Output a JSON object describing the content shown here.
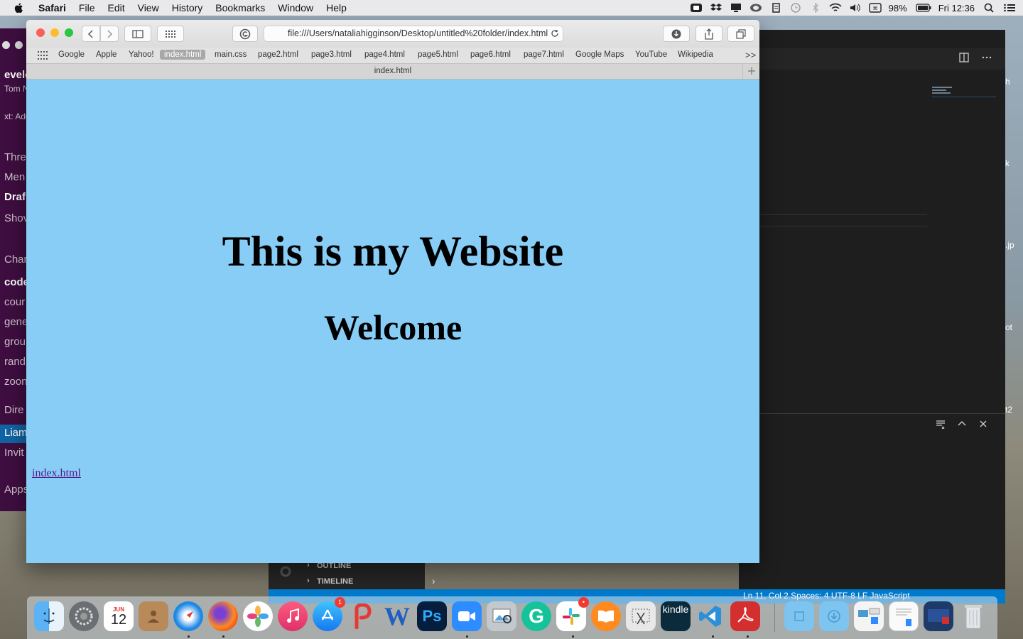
{
  "menubar": {
    "items": [
      "Safari",
      "File",
      "Edit",
      "View",
      "History",
      "Bookmarks",
      "Window",
      "Help"
    ],
    "battery": "98%",
    "clock": "Fri 12:36"
  },
  "safari": {
    "url": "file:///Users/nataliahigginson/Desktop/untitled%20folder/index.html",
    "favorites": [
      "Google",
      "Apple",
      "Yahoo!",
      "index.html",
      "main.css",
      "page2.html",
      "page3.html",
      "page4.html",
      "page5.html",
      "page6.html",
      "page7.html",
      "Google Maps",
      "YouTube",
      "Wikipedia"
    ],
    "favorites_more": ">>",
    "tab_title": "index.html",
    "page": {
      "heading": "This is my Website",
      "subheading": "Welcome",
      "link": "index.html"
    }
  },
  "slack_sidebar": {
    "top_title": "evelop",
    "top_sub": "Tom N",
    "top_sub2": "xt: Add",
    "items": [
      "Thre",
      "Men",
      "Draf",
      "Shov",
      "Char",
      "code",
      "cour",
      "gene",
      "grou",
      "rand",
      "zoon",
      "Dire",
      "Liam",
      "Invit",
      "Apps"
    ]
  },
  "vscode": {
    "outline": "OUTLINE",
    "timeline": "TIMELINE",
    "status_right": "Ln 11, Col 2    Spaces: 4    UTF-8    LF    JavaScript"
  },
  "right_strip": [
    "h",
    "k",
    ".jp",
    "ot",
    "t2"
  ],
  "dock": {
    "calendar_month": "JUN",
    "calendar_day": "12",
    "appstore_badge": "1",
    "kindle_label": "kindle"
  }
}
